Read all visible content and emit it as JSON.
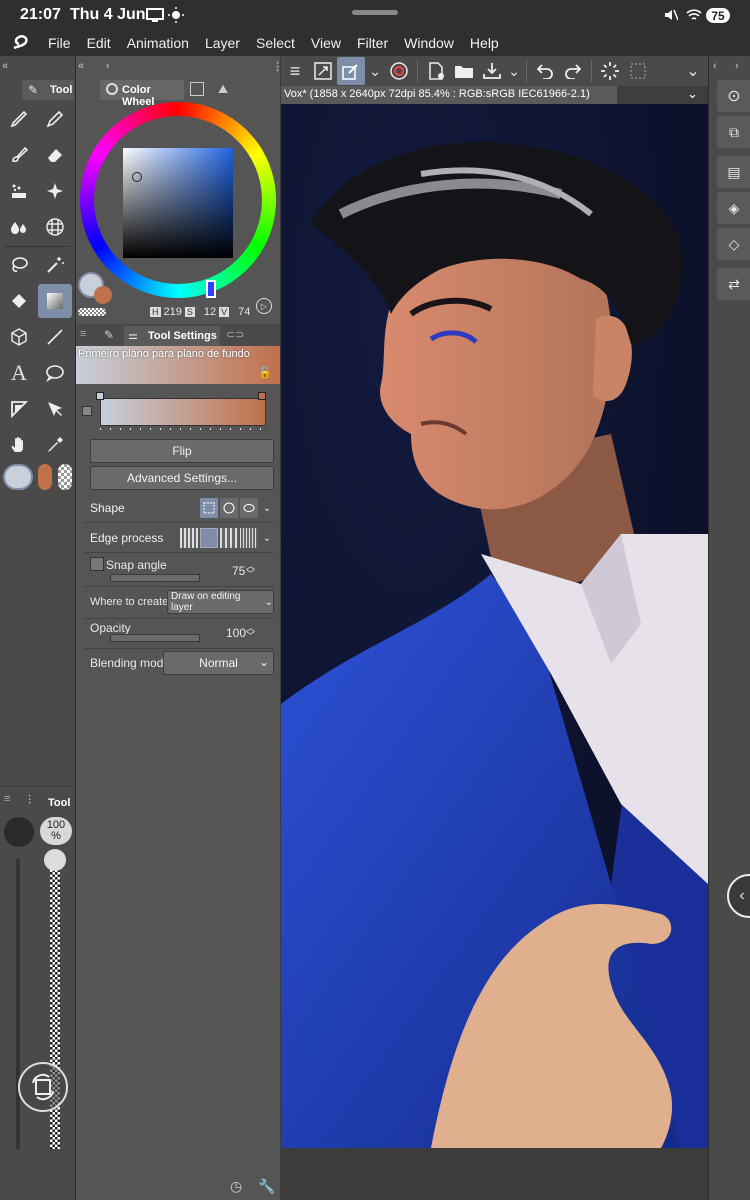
{
  "status": {
    "time": "21:07",
    "date": "Thu 4 Jun",
    "battery": "75"
  },
  "menu": [
    "File",
    "Edit",
    "Animation",
    "Layer",
    "Select",
    "View",
    "Filter",
    "Window",
    "Help"
  ],
  "left_panel": {
    "tab_label": "Tool"
  },
  "color_wheel": {
    "tab_label": "Color Wheel",
    "h_label": "H",
    "h_value": "219",
    "s_label": "S",
    "s_value": "12",
    "v_label": "V",
    "v_value": "74",
    "main_color": "#c8d0dc",
    "sub_color": "#c0704a"
  },
  "tool_settings": {
    "tab_label": "Tool Settings",
    "preset_name": "Primeiro plano para plano de fundo",
    "flip_label": "Flip",
    "advanced_label": "Advanced Settings...",
    "shape_label": "Shape",
    "edge_label": "Edge process",
    "snap_label": "Snap angle",
    "snap_value": "75",
    "where_label": "Where to create",
    "where_value": "Draw on editing layer",
    "opacity_label": "Opacity",
    "opacity_value": "100",
    "blend_label": "Blending mode",
    "blend_value": "Normal"
  },
  "lower_panel": {
    "tab_label": "Tool",
    "size_value": "100",
    "size_unit": "%"
  },
  "document": {
    "title": "Vox* (1858 x 2640px 72dpi 85.4% : RGB:sRGB IEC61966-2.1)"
  }
}
